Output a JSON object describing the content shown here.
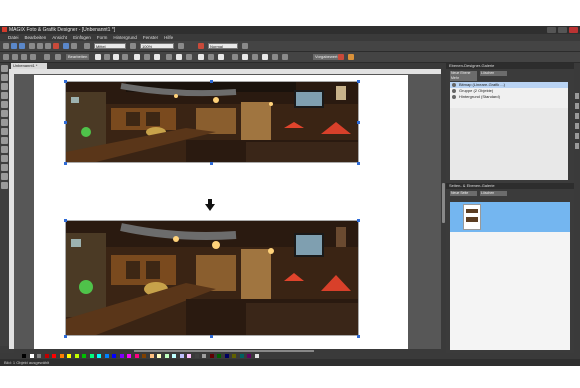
{
  "window": {
    "title": "MAGIX Foto & Grafik Designer - [Unbenannt1 *]"
  },
  "menu": [
    "Datei",
    "Bearbeiten",
    "Ansicht",
    "Einfügen",
    "Form",
    "Hintergrund",
    "Fenster",
    "Hilfe"
  ],
  "toolbar": {
    "font_size": "Mittel",
    "zoom": "100%",
    "quality": "Normal",
    "edit_button": "Bearbeiten",
    "export_button": "Vorgabewert"
  },
  "doc_tab": "Unbenannt1 *",
  "layers_panel": {
    "title": "Ebenen-Designer-Galerie",
    "buttons": [
      "Neue Ebene",
      "Löschen",
      "Mehr"
    ],
    "items": [
      {
        "label": "Bitmap (Lineare-Grafik ...)",
        "selected": true
      },
      {
        "label": "Gruppe (2 Objekte)",
        "selected": false
      },
      {
        "label": "Hintergrund (Standard)",
        "selected": false
      }
    ]
  },
  "page_gallery": {
    "title": "Seiten- & Ebenen-Galerie",
    "buttons": [
      "Neue Seite",
      "Löschen"
    ]
  },
  "status": "Bild: 1 Objekt ausgewählt",
  "colors": {
    "accent_selection": "#74b6f0",
    "annotation_circle": "#e02020"
  },
  "palette": [
    "#000000",
    "#ffffff",
    "#7f7f7f",
    "#c00000",
    "#ff0000",
    "#ff7f00",
    "#ffff00",
    "#c0ff00",
    "#00c000",
    "#00ff7f",
    "#00ffff",
    "#0080ff",
    "#0000ff",
    "#8000ff",
    "#ff00ff",
    "#ff0080",
    "#804000",
    "#ffc080",
    "#ffffc0",
    "#c0ffc0",
    "#c0ffff",
    "#c0c0ff",
    "#ffc0ff",
    "#404040",
    "#a0a0a0",
    "#600000",
    "#006000",
    "#000060",
    "#606000",
    "#006060",
    "#600060",
    "#e0e0e0"
  ]
}
